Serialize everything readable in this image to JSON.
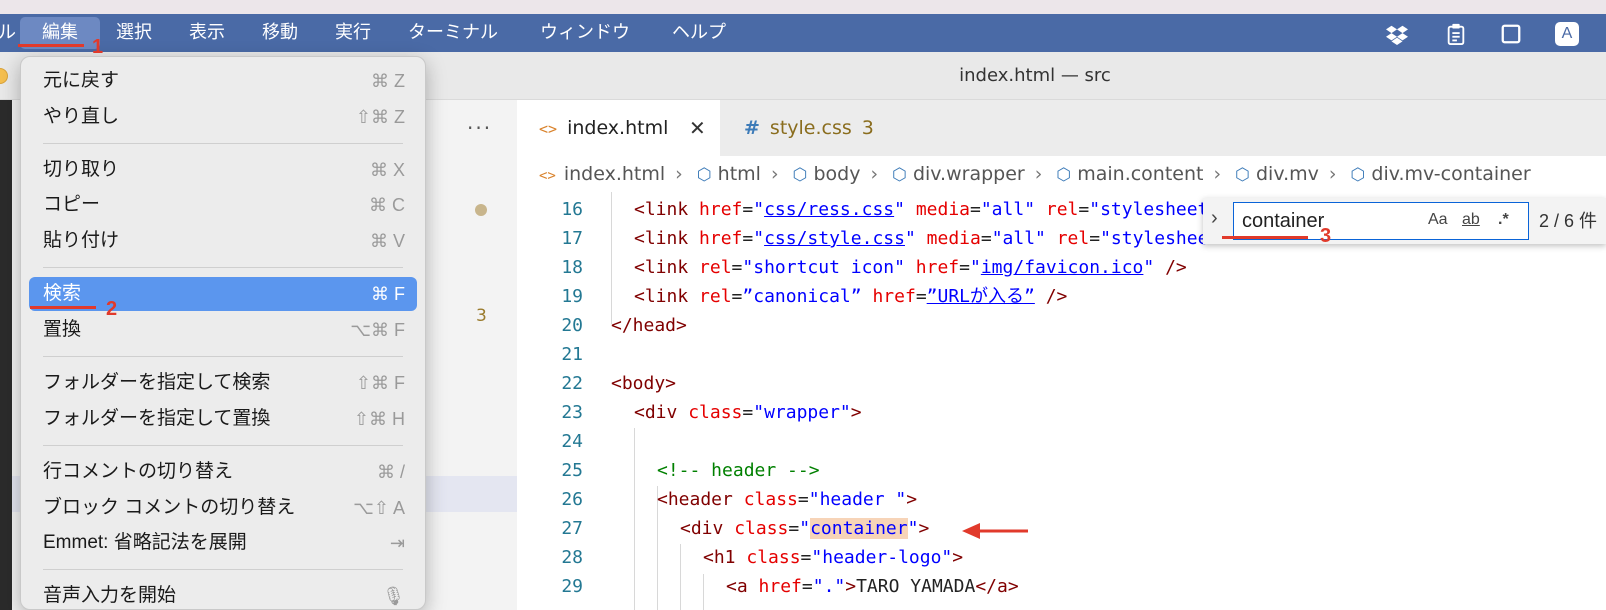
{
  "menubar": {
    "partial_left": "ル",
    "items": [
      "編集",
      "選択",
      "表示",
      "移動",
      "実行",
      "ターミナル",
      "ウィンドウ",
      "ヘルプ"
    ],
    "tray": {
      "letter": "A",
      "icons": [
        "dropbox-icon",
        "clipboard-icon",
        "window-icon"
      ]
    }
  },
  "window": {
    "title": "index.html — src"
  },
  "sidebar": {
    "more": "···",
    "problems_count": "3"
  },
  "tabs": [
    {
      "label": "index.html",
      "icon": "code-icon",
      "close": "✕"
    },
    {
      "label": "style.css",
      "icon": "hash-icon",
      "hash": "#",
      "count": "3"
    }
  ],
  "breadcrumb": [
    "index.html",
    "html",
    "body",
    "div.wrapper",
    "main.content",
    "div.mv",
    "div.mv-container"
  ],
  "editor": {
    "line_numbers": [
      "16",
      "17",
      "18",
      "19",
      "20",
      "21",
      "22",
      "23",
      "24",
      "25",
      "26",
      "27",
      "28",
      "29"
    ]
  },
  "find": {
    "value": "container",
    "match_case": "Aa",
    "whole_word": "ab",
    "regex": ".*",
    "result": "2 / 6 件"
  },
  "edit_menu": {
    "items": [
      {
        "label": "元に戻す",
        "shortcut": "⌘ Z"
      },
      {
        "label": "やり直し",
        "shortcut": "⇧⌘ Z"
      },
      {
        "label": "切り取り",
        "shortcut": "⌘ X"
      },
      {
        "label": "コピー",
        "shortcut": "⌘ C"
      },
      {
        "label": "貼り付け",
        "shortcut": "⌘ V"
      },
      {
        "label": "検索",
        "shortcut": "⌘ F",
        "selected": true
      },
      {
        "label": "置換",
        "shortcut": "⌥⌘ F"
      },
      {
        "label": "フォルダーを指定して検索",
        "shortcut": "⇧⌘ F"
      },
      {
        "label": "フォルダーを指定して置換",
        "shortcut": "⇧⌘ H"
      },
      {
        "label": "行コメントの切り替え",
        "shortcut": "⌘ /"
      },
      {
        "label": "ブロック コメントの切り替え",
        "shortcut": "⌥⇧ A"
      },
      {
        "label": "Emmet: 省略記法を展開",
        "shortcut": "⇥"
      },
      {
        "label": "音声入力を開始",
        "shortcut": ""
      }
    ]
  },
  "annotations": {
    "step1": "1",
    "step2": "2",
    "step3": "3"
  },
  "colors": {
    "menubar": "#4a6aa6",
    "selection": "#5b96ee",
    "annotation": "#e13a2b"
  }
}
